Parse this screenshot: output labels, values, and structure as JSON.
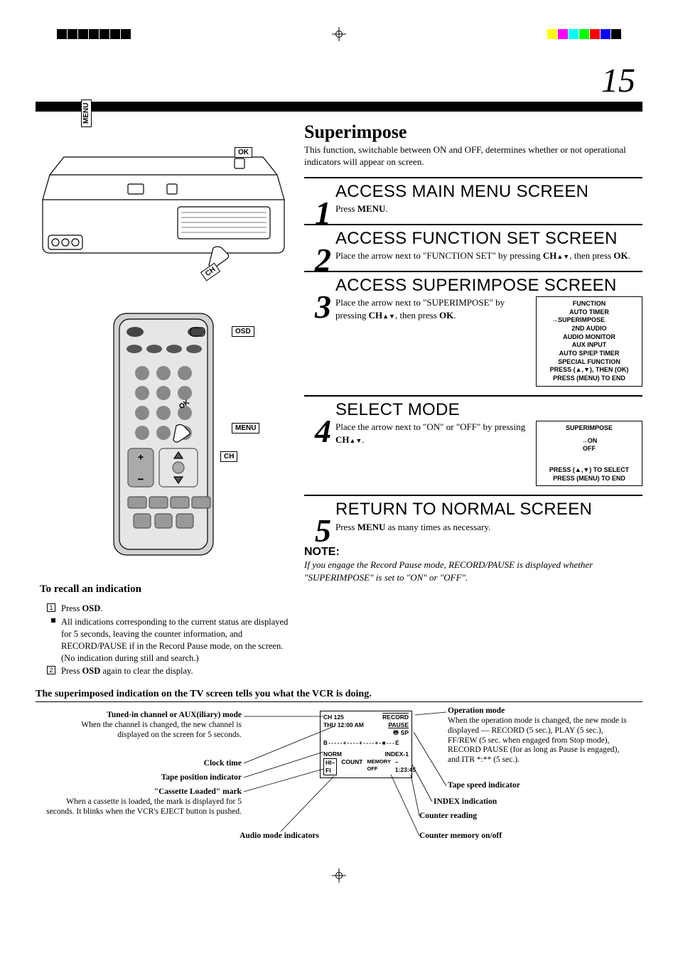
{
  "page_number": "15",
  "registration": {
    "left_count": 7,
    "right_count": 7
  },
  "left_column": {
    "labels": {
      "menu": "MENU",
      "ok": "OK",
      "ch": "CH",
      "osd": "OSD"
    },
    "recall": {
      "heading": "To recall an indication",
      "item1_pre": "Press ",
      "item1_bold": "OSD",
      "item1_post": ".",
      "bullet": "All indications corresponding to the current status are displayed for 5 seconds, leaving the counter information, and RECORD/PAUSE if in the Record Pause mode, on the screen. (No indication during still and search.)",
      "item2_pre": "Press ",
      "item2_bold": "OSD",
      "item2_post": " again to clear the display."
    }
  },
  "right_column": {
    "title": "Superimpose",
    "desc": "This function, switchable between ON and OFF, determines whether or not operational indicators will appear on screen.",
    "steps": [
      {
        "num": "1",
        "title": "ACCESS MAIN MENU SCREEN",
        "text_pre": "Press ",
        "text_bold": "MENU",
        "text_post": "."
      },
      {
        "num": "2",
        "title": "ACCESS FUNCTION SET SCREEN",
        "text_pre": "Place the arrow next to \"FUNCTION SET\" by pressing ",
        "text_bold": "CH",
        "text_mid": ", then press ",
        "text_bold2": "OK",
        "text_post": "."
      },
      {
        "num": "3",
        "title": "ACCESS SUPERIMPOSE SCREEN",
        "text_pre": "Place the arrow next to \"SUPERIMPOSE\" by pressing ",
        "text_bold": "CH",
        "text_mid": ", then press ",
        "text_bold2": "OK",
        "text_post": ".",
        "osd": {
          "header": "FUNCTION",
          "items": [
            "AUTO TIMER",
            "→SUPERIMPOSE",
            "2ND AUDIO",
            "AUDIO MONITOR",
            "AUX INPUT",
            "AUTO SP/EP TIMER",
            "SPECIAL FUNCTION"
          ],
          "footer1": "PRESS (▲,▼), THEN (OK)",
          "footer2": "PRESS (MENU) TO END"
        }
      },
      {
        "num": "4",
        "title": "SELECT MODE",
        "text_pre": "Place the arrow next to \"ON\" or \"OFF\" by pressing ",
        "text_bold": "CH",
        "text_post": ".",
        "osd": {
          "header": "SUPERIMPOSE",
          "items": [
            "→ON",
            "  OFF"
          ],
          "footer1": "PRESS (▲,▼) TO SELECT",
          "footer2": "PRESS (MENU) TO END"
        }
      },
      {
        "num": "5",
        "title": "RETURN TO NORMAL SCREEN",
        "text_pre": "Press ",
        "text_bold": "MENU",
        "text_post": " as many times as necessary."
      }
    ],
    "note": {
      "title": "NOTE:",
      "text": "If you engage the Record Pause mode, RECORD/PAUSE is displayed whether \"SUPERIMPOSE\" is set to \"ON\" or \"OFF\"."
    }
  },
  "diagram": {
    "heading": "The superimposed indication on the TV screen tells you what the VCR is doing.",
    "screen": {
      "l1": "CH   125",
      "l1r": "RECORD",
      "l2": "THU 12:00 AM",
      "l2r": "PAUSE",
      "l3r": "SP",
      "bar": "B - - - - - + - - - - + - - - - + - ■ - - - E",
      "l5a": "NORM",
      "l5b": "INDEX-1",
      "l6a": "HI–FI",
      "l6b": "COUNT",
      "l6c": "MEMORY OFF",
      "l6d": "–1:23:45"
    },
    "labels": {
      "channel_head": "Tuned-in channel or AUX(iliary) mode",
      "channel_body": "When the channel is changed, the new channel is displayed on the screen for 5 seconds.",
      "clock": "Clock time",
      "tape_pos": "Tape position indicator",
      "cassette_head": "\"Cassette Loaded\" mark",
      "cassette_body": "When a cassette is loaded, the mark is displayed for 5 seconds. It blinks when the VCR's EJECT button is pushed.",
      "audio": "Audio mode indicators",
      "opmode_head": "Operation mode",
      "opmode_body": "When the operation mode is changed, the new mode is displayed — RECORD (5 sec.), PLAY (5 sec.), FF/REW (5 sec. when engaged from Stop mode), RECORD PAUSE (for as long as Pause is engaged), and ITR *:** (5 sec.).",
      "tape_speed": "Tape speed indicator",
      "index": "INDEX indication",
      "counter_read": "Counter reading",
      "counter_mem": "Counter memory on/off"
    }
  }
}
